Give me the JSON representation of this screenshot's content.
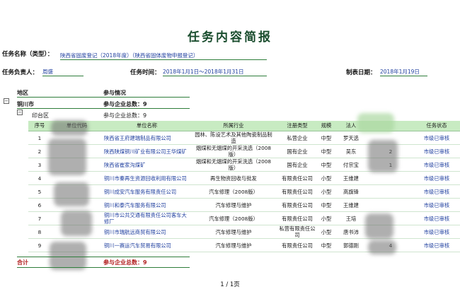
{
  "report_title": "任务内容简报",
  "task_name_label": "任务名称（类型）：",
  "task_name_value": "陕西省固废登记（2018年度）（陕西省固体废物申报登记）",
  "owner_label": "任务负责人：",
  "owner_value": "周盛",
  "time_label": "任务时间：",
  "time_value": "2018年1月1日～2018年1月31日",
  "created_label": "制表日期：",
  "created_value": "2018年1月19日",
  "col_region": "地区",
  "col_participation": "参与情况",
  "city": "铜川市",
  "city_total": "参与企业总数：9",
  "district": "印台区",
  "district_total": "参与企业总数：9",
  "table": {
    "headers": [
      "序号",
      "单位代码",
      "单位名称",
      "所属行业",
      "注册类型",
      "规模",
      "法人",
      "",
      "任务状态"
    ],
    "rows": [
      {
        "no": "1",
        "name": "陕西省王府建瑞制品有限公司",
        "industry": "园林、陈设艺术及其他陶瓷制品制造",
        "reg": "私营企业",
        "size": "中型",
        "person": "罗天选",
        "extra": "",
        "status": "市级已审核"
      },
      {
        "no": "2",
        "name": "陕西陕煤铜川矿业有限公司王华煤矿",
        "industry": "烟煤和无烟煤的开采洗选（2008版）",
        "reg": "国有企业",
        "size": "中型",
        "person": "吴东",
        "extra": "2",
        "status": "市级已审核"
      },
      {
        "no": "3",
        "name": "陕西省崔家沟煤矿",
        "industry": "烟煤和无烟煤的开采洗选（2008版）",
        "reg": "国有企业",
        "size": "中型",
        "person": "付宗宝",
        "extra": "1",
        "status": "市级已审核"
      },
      {
        "no": "4",
        "name": "铜川市秦再生资源回收利用有限公司",
        "industry": "再生物资回收与批发",
        "reg": "有限责任公司",
        "size": "小型",
        "person": "王维建",
        "extra": "",
        "status": "市级已审核"
      },
      {
        "no": "5",
        "name": "铜川成安汽车服务有限责任公司",
        "industry": "汽车修理（2008版）",
        "reg": "有限责任公司",
        "size": "小型",
        "person": "高旗锋",
        "extra": "",
        "status": "市级已审核"
      },
      {
        "no": "6",
        "name": "铜川和泰汽车服务有限公司",
        "industry": "汽车修理与维护",
        "reg": "有限责任公司",
        "size": "中型",
        "person": "王维建",
        "extra": "",
        "status": "市级已审核"
      },
      {
        "no": "7",
        "name": "铜川市公共交通有限责任公司客车大修厂",
        "industry": "汽车修理（2008版）",
        "reg": "有限责任公司",
        "size": "小型",
        "person": "王培",
        "extra": "",
        "status": "市级已审核"
      },
      {
        "no": "8",
        "name": "铜川市瑞航远商贸有限公司",
        "industry": "汽车修理与维护",
        "reg": "私营有限责任公司",
        "size": "小型",
        "person": "唐书沛",
        "extra": "",
        "status": "市级已审核"
      },
      {
        "no": "9",
        "name": "铜川一赛运汽车贸易有限公司",
        "industry": "汽车修理与维护",
        "reg": "有限责任公司",
        "size": "中型",
        "person": "郭德刚",
        "extra": "4",
        "status": "市级已审核"
      }
    ]
  },
  "total_label": "合计",
  "total_value": "参与企业总数：9",
  "pager": "1 / 1页"
}
